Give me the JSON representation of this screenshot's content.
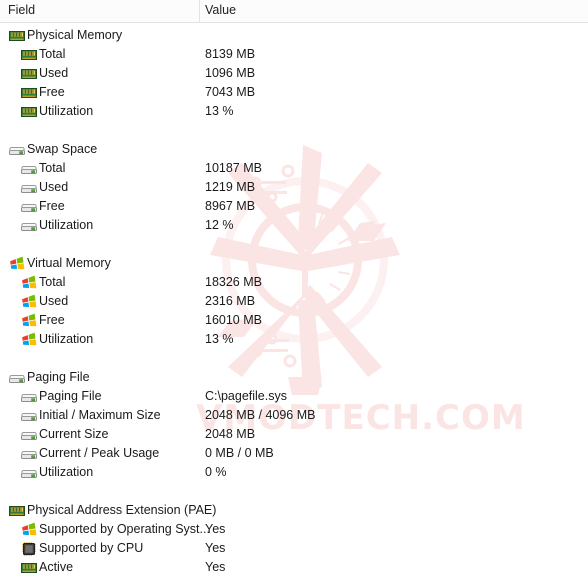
{
  "header": {
    "field_label": "Field",
    "value_label": "Value"
  },
  "watermark": {
    "text": "VMODTECH.COM",
    "color": "#fbe4e4"
  },
  "rows": [
    {
      "level": 0,
      "icon": "memory-module-icon",
      "label": "Physical Memory",
      "value": ""
    },
    {
      "level": 1,
      "icon": "memory-module-icon",
      "label": "Total",
      "value": "8139 MB"
    },
    {
      "level": 1,
      "icon": "memory-module-icon",
      "label": "Used",
      "value": "1096 MB"
    },
    {
      "level": 1,
      "icon": "memory-module-icon",
      "label": "Free",
      "value": "7043 MB"
    },
    {
      "level": 1,
      "icon": "memory-module-icon",
      "label": "Utilization",
      "value": "13 %"
    },
    {
      "level": 0,
      "icon": "spacer",
      "label": "",
      "value": ""
    },
    {
      "level": 0,
      "icon": "hard-drive-icon",
      "label": "Swap Space",
      "value": ""
    },
    {
      "level": 1,
      "icon": "hard-drive-icon",
      "label": "Total",
      "value": "10187 MB"
    },
    {
      "level": 1,
      "icon": "hard-drive-icon",
      "label": "Used",
      "value": "1219 MB"
    },
    {
      "level": 1,
      "icon": "hard-drive-icon",
      "label": "Free",
      "value": "8967 MB"
    },
    {
      "level": 1,
      "icon": "hard-drive-icon",
      "label": "Utilization",
      "value": "12 %"
    },
    {
      "level": 0,
      "icon": "spacer",
      "label": "",
      "value": ""
    },
    {
      "level": 0,
      "icon": "windows-logo-icon",
      "label": "Virtual Memory",
      "value": ""
    },
    {
      "level": 1,
      "icon": "windows-logo-icon",
      "label": "Total",
      "value": "18326 MB"
    },
    {
      "level": 1,
      "icon": "windows-logo-icon",
      "label": "Used",
      "value": "2316 MB"
    },
    {
      "level": 1,
      "icon": "windows-logo-icon",
      "label": "Free",
      "value": "16010 MB"
    },
    {
      "level": 1,
      "icon": "windows-logo-icon",
      "label": "Utilization",
      "value": "13 %"
    },
    {
      "level": 0,
      "icon": "spacer",
      "label": "",
      "value": ""
    },
    {
      "level": 0,
      "icon": "hard-drive-icon",
      "label": "Paging File",
      "value": ""
    },
    {
      "level": 1,
      "icon": "hard-drive-icon",
      "label": "Paging File",
      "value": "C:\\pagefile.sys"
    },
    {
      "level": 1,
      "icon": "hard-drive-icon",
      "label": "Initial / Maximum Size",
      "value": "2048 MB / 4096 MB"
    },
    {
      "level": 1,
      "icon": "hard-drive-icon",
      "label": "Current Size",
      "value": "2048 MB"
    },
    {
      "level": 1,
      "icon": "hard-drive-icon",
      "label": "Current / Peak Usage",
      "value": "0 MB / 0 MB"
    },
    {
      "level": 1,
      "icon": "hard-drive-icon",
      "label": "Utilization",
      "value": "0 %"
    },
    {
      "level": 0,
      "icon": "spacer",
      "label": "",
      "value": ""
    },
    {
      "level": 0,
      "icon": "memory-module-icon",
      "label": "Physical Address Extension (PAE)",
      "value": ""
    },
    {
      "level": 1,
      "icon": "windows-logo-icon",
      "label": "Supported by Operating Syst...",
      "value": "Yes"
    },
    {
      "level": 1,
      "icon": "cpu-chip-icon",
      "label": "Supported by CPU",
      "value": "Yes"
    },
    {
      "level": 1,
      "icon": "memory-module-icon",
      "label": "Active",
      "value": "Yes"
    }
  ]
}
